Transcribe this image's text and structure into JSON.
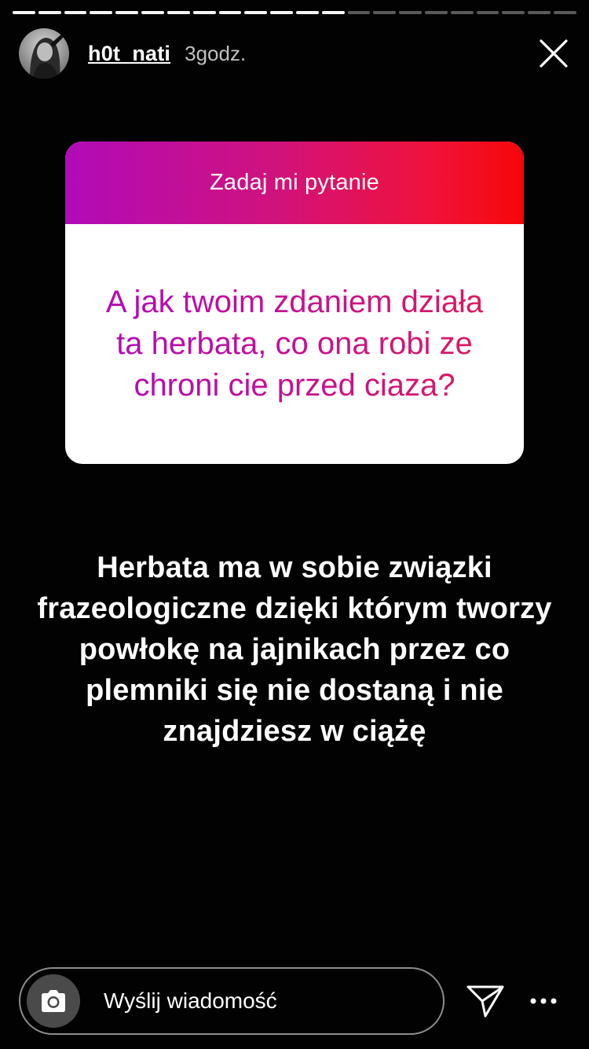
{
  "story": {
    "progress": {
      "segment_count": 22,
      "completed_segments": 13
    },
    "header": {
      "username": "h0t_nati",
      "time": "3godz.",
      "close_icon": "close-icon"
    },
    "question_sticker": {
      "title": "Zadaj mi pytanie",
      "question": "A jak twoim zdaniem działa ta herbata, co ona robi ze chroni cie przed ciaza?",
      "gradient_colors": [
        "#b10bb8",
        "#f70608"
      ]
    },
    "answer": {
      "text": "Herbata ma w sobie związki frazeologiczne dzięki którym tworzy powłokę na jajnikach przez co plemniki się nie dostaną i nie znajdziesz w ciążę"
    },
    "reply_bar": {
      "camera_icon": "camera-icon",
      "placeholder": "Wyślij wiadomość",
      "send_icon": "send-icon",
      "more_icon": "more-icon"
    }
  }
}
